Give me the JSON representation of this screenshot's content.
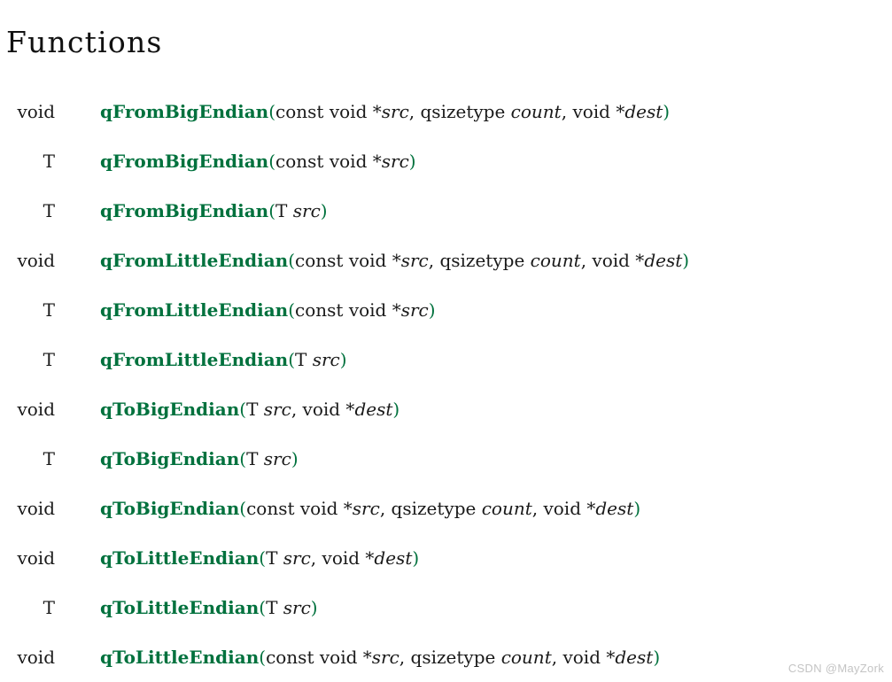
{
  "page": {
    "title": "Functions",
    "background_color": "#ffffff",
    "link_color": "#00713d",
    "text_color": "#1a1a1a",
    "watermark": "CSDN @MayZork"
  },
  "functions": [
    {
      "return_type": "void",
      "name": "qFromBigEndian",
      "open_paren": "(",
      "params": "const void *src, qsizetype count, void *dest",
      "close_paren": ")",
      "signature": "void qFromBigEndian(const void *src, qsizetype count, void *dest)"
    },
    {
      "return_type": "T",
      "name": "qFromBigEndian",
      "open_paren": "(",
      "params": "const void *src",
      "close_paren": ")",
      "signature": "T qFromBigEndian(const void *src)"
    },
    {
      "return_type": "T",
      "name": "qFromBigEndian",
      "open_paren": "(",
      "params": "T src",
      "close_paren": ")",
      "signature": "T qFromBigEndian(T src)"
    },
    {
      "return_type": "void",
      "name": "qFromLittleEndian",
      "open_paren": "(",
      "params": "const void *src, qsizetype count, void *dest",
      "close_paren": ")",
      "signature": "void qFromLittleEndian(const void *src, qsizetype count, void *dest)"
    },
    {
      "return_type": "T",
      "name": "qFromLittleEndian",
      "open_paren": "(",
      "params": "const void *src",
      "close_paren": ")",
      "signature": "T qFromLittleEndian(const void *src)"
    },
    {
      "return_type": "T",
      "name": "qFromLittleEndian",
      "open_paren": "(",
      "params": "T src",
      "close_paren": ")",
      "signature": "T qFromLittleEndian(T src)"
    },
    {
      "return_type": "void",
      "name": "qToBigEndian",
      "open_paren": "(",
      "params": "T src, void *dest",
      "close_paren": ")",
      "signature": "void qToBigEndian(T src, void *dest)"
    },
    {
      "return_type": "T",
      "name": "qToBigEndian",
      "open_paren": "(",
      "params": "T src",
      "close_paren": ")",
      "signature": "T qToBigEndian(T src)"
    },
    {
      "return_type": "void",
      "name": "qToBigEndian",
      "open_paren": "(",
      "params": "const void *src, qsizetype count, void *dest",
      "close_paren": ")",
      "signature": "void qToBigEndian(const void *src, qsizetype count, void *dest)"
    },
    {
      "return_type": "void",
      "name": "qToLittleEndian",
      "open_paren": "(",
      "params": "T src, void *dest",
      "close_paren": ")",
      "signature": "void qToLittleEndian(T src, void *dest)"
    },
    {
      "return_type": "T",
      "name": "qToLittleEndian",
      "open_paren": "(",
      "params": "T src",
      "close_paren": ")",
      "signature": "T qToLittleEndian(T src)"
    },
    {
      "return_type": "void",
      "name": "qToLittleEndian",
      "open_paren": "(",
      "params": "const void *src, qsizetype count, void *dest",
      "close_paren": ")",
      "signature": "void qToLittleEndian(const void *src, qsizetype count, void *dest)"
    }
  ],
  "param_italic_tokens": [
    "src",
    "dest",
    "count"
  ]
}
